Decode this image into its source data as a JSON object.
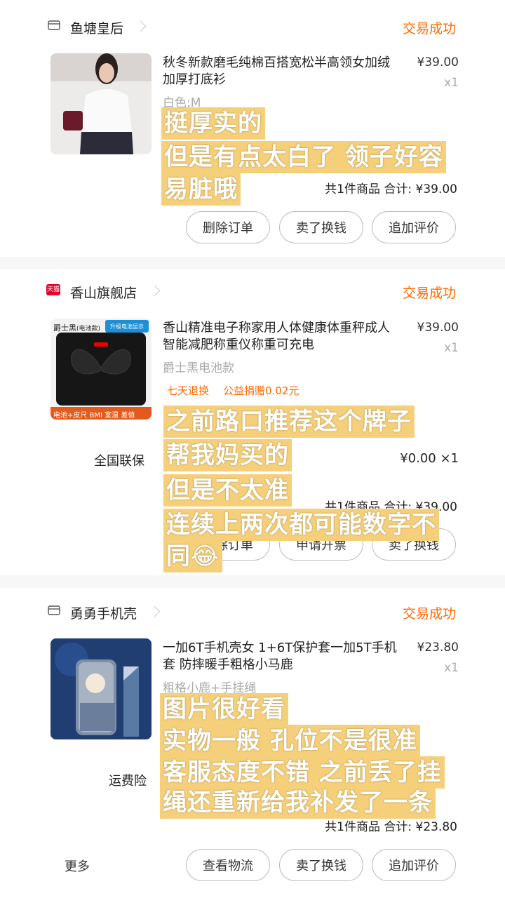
{
  "orders": [
    {
      "shop": "鱼塘皇后",
      "status": "交易成功",
      "title": "秋冬新款磨毛纯棉百搭宽松半高领女加绒加厚打底衫",
      "price": "¥39.00",
      "qty": "x1",
      "sku": "白色;M",
      "summary": "共1件商品  合计: ¥39.00",
      "buttons": [
        "删除订单",
        "卖了换钱",
        "追加评价"
      ],
      "overlay": [
        "挺厚实的",
        "但是有点太白了  领子好容",
        "易脏哦"
      ]
    },
    {
      "shop": "香山旗舰店",
      "shop_badge": "天猫",
      "status": "交易成功",
      "title": "香山精准电子称家用人体健康体重秤成人智能减肥称重仪称重可充电",
      "price": "¥39.00",
      "qty": "x1",
      "sku": "爵士黑电池款",
      "tags": [
        "七天退换",
        "公益捐赠0.02元"
      ],
      "service_label": "全国联保",
      "service_price": "¥0.00 ×1",
      "summary": "共1件商品  合计: ¥39.00",
      "buttons": [
        "删除订单",
        "申请开票",
        "卖了换钱"
      ],
      "thumb_text": {
        "brand": "爵士黑",
        "sub": "(电池款)",
        "badge": "升级电池显示",
        "footer": "电池+皮尺  BMI 室温 差值"
      },
      "overlay": [
        "之前路口推荐这个牌子",
        "帮我妈买的",
        "但是不太准",
        "连续上两次都可能数字不",
        "同😂"
      ]
    },
    {
      "shop": "勇勇手机壳",
      "status": "交易成功",
      "title": "一加6T手机壳女 1+6T保护套一加5T手机套 防摔暖手粗格小马鹿",
      "price": "¥23.80",
      "qty": "x1",
      "sku": "粗格小鹿+手挂绳",
      "service_label": "运费险",
      "summary": "共1件商品  合计: ¥23.80",
      "more": "更多",
      "buttons": [
        "查看物流",
        "卖了换钱",
        "追加评价"
      ],
      "overlay": [
        "图片很好看",
        "实物一般  孔位不是很准",
        "客服态度不错  之前丢了挂",
        "绳还重新给我补发了一条"
      ]
    }
  ],
  "colors": {
    "accent": "#ff6a00",
    "overlay": "#f5cf7a"
  }
}
